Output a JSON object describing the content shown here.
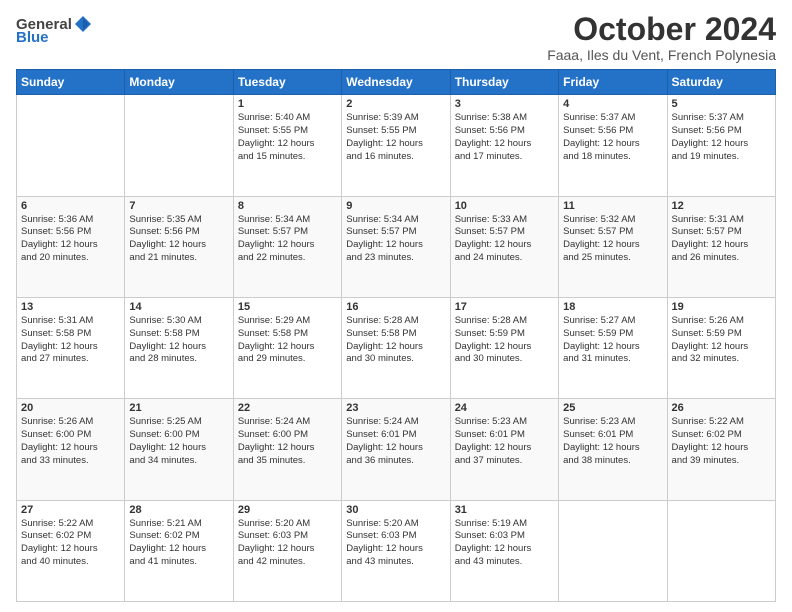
{
  "logo": {
    "text_general": "General",
    "text_blue": "Blue"
  },
  "header": {
    "title": "October 2024",
    "subtitle": "Faaa, Iles du Vent, French Polynesia"
  },
  "weekdays": [
    "Sunday",
    "Monday",
    "Tuesday",
    "Wednesday",
    "Thursday",
    "Friday",
    "Saturday"
  ],
  "weeks": [
    [
      {
        "day": "",
        "content": ""
      },
      {
        "day": "",
        "content": ""
      },
      {
        "day": "1",
        "content": "Sunrise: 5:40 AM\nSunset: 5:55 PM\nDaylight: 12 hours\nand 15 minutes."
      },
      {
        "day": "2",
        "content": "Sunrise: 5:39 AM\nSunset: 5:55 PM\nDaylight: 12 hours\nand 16 minutes."
      },
      {
        "day": "3",
        "content": "Sunrise: 5:38 AM\nSunset: 5:56 PM\nDaylight: 12 hours\nand 17 minutes."
      },
      {
        "day": "4",
        "content": "Sunrise: 5:37 AM\nSunset: 5:56 PM\nDaylight: 12 hours\nand 18 minutes."
      },
      {
        "day": "5",
        "content": "Sunrise: 5:37 AM\nSunset: 5:56 PM\nDaylight: 12 hours\nand 19 minutes."
      }
    ],
    [
      {
        "day": "6",
        "content": "Sunrise: 5:36 AM\nSunset: 5:56 PM\nDaylight: 12 hours\nand 20 minutes."
      },
      {
        "day": "7",
        "content": "Sunrise: 5:35 AM\nSunset: 5:56 PM\nDaylight: 12 hours\nand 21 minutes."
      },
      {
        "day": "8",
        "content": "Sunrise: 5:34 AM\nSunset: 5:57 PM\nDaylight: 12 hours\nand 22 minutes."
      },
      {
        "day": "9",
        "content": "Sunrise: 5:34 AM\nSunset: 5:57 PM\nDaylight: 12 hours\nand 23 minutes."
      },
      {
        "day": "10",
        "content": "Sunrise: 5:33 AM\nSunset: 5:57 PM\nDaylight: 12 hours\nand 24 minutes."
      },
      {
        "day": "11",
        "content": "Sunrise: 5:32 AM\nSunset: 5:57 PM\nDaylight: 12 hours\nand 25 minutes."
      },
      {
        "day": "12",
        "content": "Sunrise: 5:31 AM\nSunset: 5:57 PM\nDaylight: 12 hours\nand 26 minutes."
      }
    ],
    [
      {
        "day": "13",
        "content": "Sunrise: 5:31 AM\nSunset: 5:58 PM\nDaylight: 12 hours\nand 27 minutes."
      },
      {
        "day": "14",
        "content": "Sunrise: 5:30 AM\nSunset: 5:58 PM\nDaylight: 12 hours\nand 28 minutes."
      },
      {
        "day": "15",
        "content": "Sunrise: 5:29 AM\nSunset: 5:58 PM\nDaylight: 12 hours\nand 29 minutes."
      },
      {
        "day": "16",
        "content": "Sunrise: 5:28 AM\nSunset: 5:58 PM\nDaylight: 12 hours\nand 30 minutes."
      },
      {
        "day": "17",
        "content": "Sunrise: 5:28 AM\nSunset: 5:59 PM\nDaylight: 12 hours\nand 30 minutes."
      },
      {
        "day": "18",
        "content": "Sunrise: 5:27 AM\nSunset: 5:59 PM\nDaylight: 12 hours\nand 31 minutes."
      },
      {
        "day": "19",
        "content": "Sunrise: 5:26 AM\nSunset: 5:59 PM\nDaylight: 12 hours\nand 32 minutes."
      }
    ],
    [
      {
        "day": "20",
        "content": "Sunrise: 5:26 AM\nSunset: 6:00 PM\nDaylight: 12 hours\nand 33 minutes."
      },
      {
        "day": "21",
        "content": "Sunrise: 5:25 AM\nSunset: 6:00 PM\nDaylight: 12 hours\nand 34 minutes."
      },
      {
        "day": "22",
        "content": "Sunrise: 5:24 AM\nSunset: 6:00 PM\nDaylight: 12 hours\nand 35 minutes."
      },
      {
        "day": "23",
        "content": "Sunrise: 5:24 AM\nSunset: 6:01 PM\nDaylight: 12 hours\nand 36 minutes."
      },
      {
        "day": "24",
        "content": "Sunrise: 5:23 AM\nSunset: 6:01 PM\nDaylight: 12 hours\nand 37 minutes."
      },
      {
        "day": "25",
        "content": "Sunrise: 5:23 AM\nSunset: 6:01 PM\nDaylight: 12 hours\nand 38 minutes."
      },
      {
        "day": "26",
        "content": "Sunrise: 5:22 AM\nSunset: 6:02 PM\nDaylight: 12 hours\nand 39 minutes."
      }
    ],
    [
      {
        "day": "27",
        "content": "Sunrise: 5:22 AM\nSunset: 6:02 PM\nDaylight: 12 hours\nand 40 minutes."
      },
      {
        "day": "28",
        "content": "Sunrise: 5:21 AM\nSunset: 6:02 PM\nDaylight: 12 hours\nand 41 minutes."
      },
      {
        "day": "29",
        "content": "Sunrise: 5:20 AM\nSunset: 6:03 PM\nDaylight: 12 hours\nand 42 minutes."
      },
      {
        "day": "30",
        "content": "Sunrise: 5:20 AM\nSunset: 6:03 PM\nDaylight: 12 hours\nand 43 minutes."
      },
      {
        "day": "31",
        "content": "Sunrise: 5:19 AM\nSunset: 6:03 PM\nDaylight: 12 hours\nand 43 minutes."
      },
      {
        "day": "",
        "content": ""
      },
      {
        "day": "",
        "content": ""
      }
    ]
  ]
}
